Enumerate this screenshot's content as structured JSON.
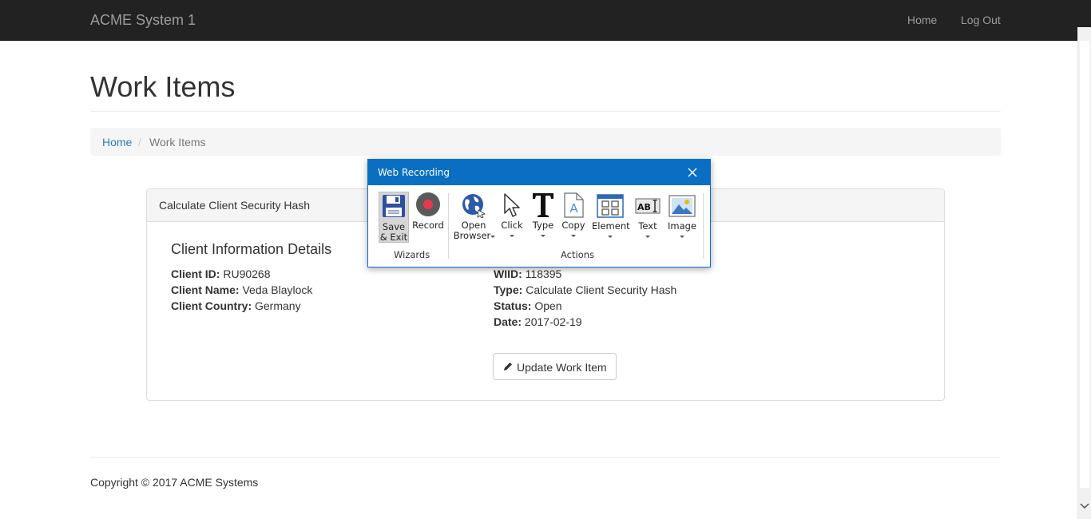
{
  "navbar": {
    "brand": "ACME System 1",
    "home": "Home",
    "logout": "Log Out"
  },
  "page": {
    "title": "Work Items"
  },
  "breadcrumb": {
    "home": "Home",
    "separator": "/",
    "current": "Work Items"
  },
  "panel": {
    "heading": "Calculate Client Security Hash",
    "section_title": "Client Information Details",
    "left_fields": [
      {
        "label": "Client ID:",
        "value": "RU90268"
      },
      {
        "label": "Client Name:",
        "value": "Veda Blaylock"
      },
      {
        "label": "Client Country:",
        "value": "Germany"
      }
    ],
    "right_fields": [
      {
        "label": "WIID:",
        "value": "118395"
      },
      {
        "label": "Type:",
        "value": "Calculate Client Security Hash"
      },
      {
        "label": "Status:",
        "value": "Open"
      },
      {
        "label": "Date:",
        "value": "2017-02-19"
      }
    ],
    "update_button": "Update Work Item"
  },
  "footer": {
    "text": "Copyright © 2017 ACME Systems"
  },
  "dialog": {
    "title": "Web Recording",
    "wizards": {
      "label": "Wizards",
      "save_line1": "Save",
      "save_line2": "& Exit",
      "record": "Record"
    },
    "actions": {
      "label": "Actions",
      "open_line1": "Open",
      "open_line2": "Browser",
      "click": "Click",
      "type": "Type",
      "copy": "Copy",
      "element": "Element",
      "text": "Text",
      "image": "Image"
    }
  },
  "colors": {
    "navbar": "#222222",
    "link": "#337ab7",
    "dialog_title": "#0a6fc2",
    "record": "#e8394c"
  }
}
